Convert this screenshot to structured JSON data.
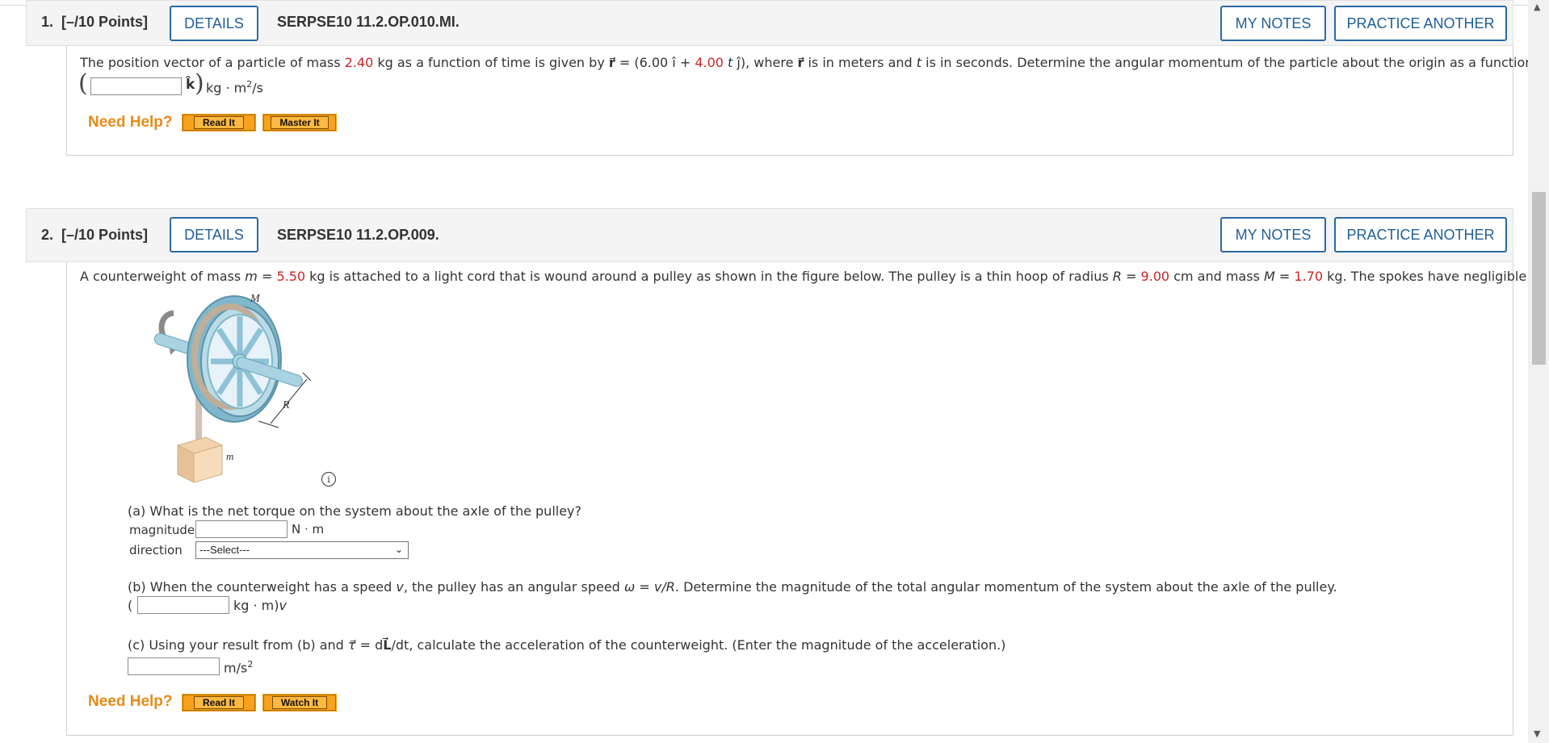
{
  "q1": {
    "number": "1.",
    "points": "[–/10 Points]",
    "details": "DETAILS",
    "code": "SERPSE10 11.2.OP.010.MI.",
    "my_notes": "MY NOTES",
    "practice": "PRACTICE ANOTHER",
    "t1": "The position vector of a particle of mass ",
    "mass": "2.40",
    "t2": " kg as a function of time is given by ",
    "r": "r",
    "t3": " = (6.00 ",
    "ihat": "î",
    "t4": " + ",
    "coef": "4.00",
    "t5": " t ",
    "jhat": "ĵ",
    "t6": "), where ",
    "t7": " is in meters and ",
    "t8": "t",
    "t9": " is in seconds. Determine the angular momentum of the particle about the origin as a function of time.",
    "khat": "k̂",
    "unit": "kg · m",
    "unit_sup": "2",
    "unit_tail": "/s",
    "answer": "",
    "need_help": "Need Help?",
    "read_it": "Read It",
    "master_it": "Master It"
  },
  "q2": {
    "number": "2.",
    "points": "[–/10 Points]",
    "details": "DETAILS",
    "code": "SERPSE10 11.2.OP.009.",
    "my_notes": "MY NOTES",
    "practice": "PRACTICE ANOTHER",
    "intro_a": "A counterweight of mass ",
    "m_sym": "m",
    "eq": " = ",
    "m_val": "5.50",
    "intro_b": " kg is attached to a light cord that is wound around a pulley as shown in the figure below. The pulley is a thin hoop of radius ",
    "R_sym": "R",
    "R_val": "9.00",
    "intro_c": " cm and mass ",
    "M_sym": "M",
    "M_val": "1.70",
    "intro_d": " kg. The spokes have negligible mass.",
    "fig_M": "M",
    "fig_R": "R",
    "fig_m": "m",
    "info": "i",
    "a_text": "(a) What is the net torque on the system about the axle of the pulley?",
    "mag_label": "magnitude",
    "mag_unit": "N · m",
    "dir_label": "direction",
    "dir_select": "---Select---",
    "b_text1": "(b) When the counterweight has a speed ",
    "b_v": "v",
    "b_text2": ", the pulley has an angular speed ",
    "b_omega": "ω",
    "b_text3": " = ",
    "b_vR": "v/R",
    "b_text4": ". Determine the magnitude of the total angular momentum of the system about the axle of the pulley.",
    "b_open": "(",
    "b_unit": "kg · m)",
    "b_unit_v": "v",
    "c_text1": "(c) Using your result from (b) and ",
    "c_tau": "τ",
    "c_text2": " = d",
    "c_L": "L",
    "c_text3": "/dt, calculate the acceleration of the counterweight. (Enter the magnitude of the acceleration.)",
    "c_unit": "m/s",
    "c_sup": "2",
    "need_help": "Need Help?",
    "read_it": "Read It",
    "watch_it": "Watch It"
  }
}
